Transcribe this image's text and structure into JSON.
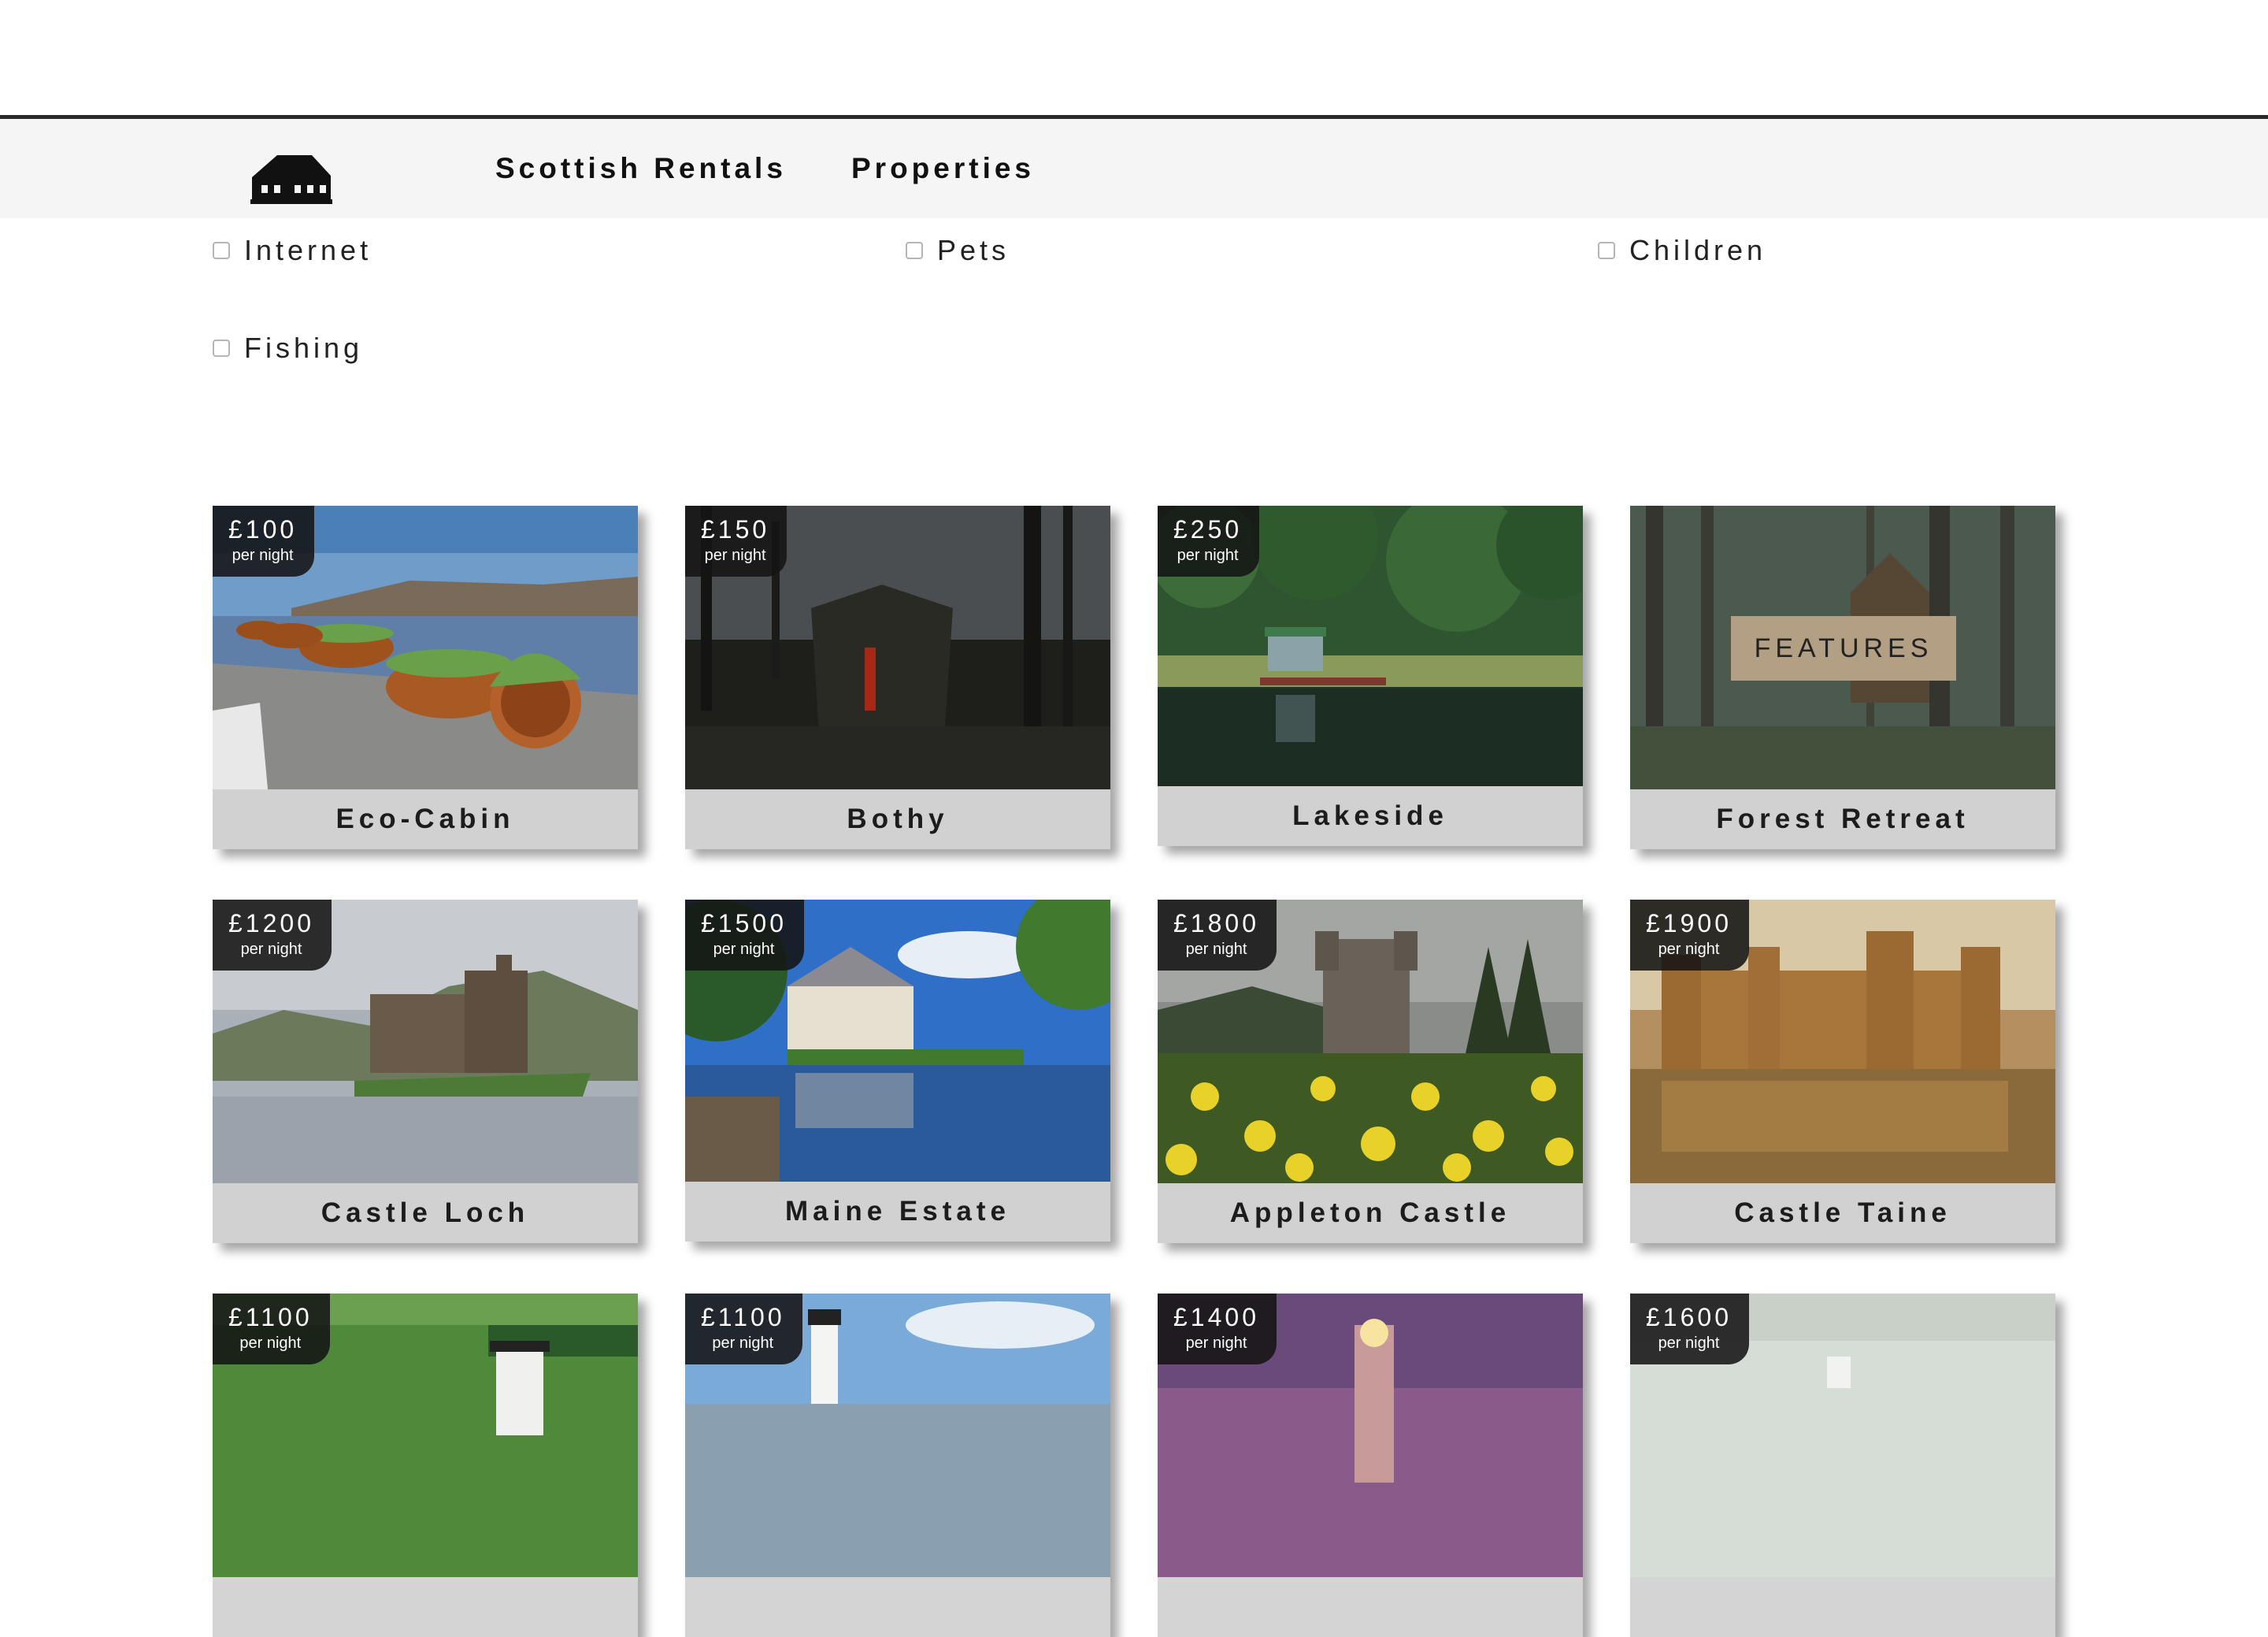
{
  "nav": {
    "logo": "cabin-logo-icon",
    "links": [
      "Scottish Rentals",
      "Properties"
    ]
  },
  "filters": [
    {
      "label": "Internet",
      "checked": false
    },
    {
      "label": "Pets",
      "checked": false
    },
    {
      "label": "Children",
      "checked": false
    },
    {
      "label": "Fishing",
      "checked": false
    }
  ],
  "properties": [
    {
      "name": "Eco-Cabin",
      "price": "£100",
      "unit": "per night"
    },
    {
      "name": "Bothy",
      "price": "£150",
      "unit": "per night"
    },
    {
      "name": "Lakeside",
      "price": "£250",
      "unit": "per night"
    },
    {
      "name": "Forest Retreat",
      "price": "",
      "unit": "",
      "overlay": "FEATURES"
    },
    {
      "name": "Castle Loch",
      "price": "£1200",
      "unit": "per night"
    },
    {
      "name": "Maine Estate",
      "price": "£1500",
      "unit": "per night"
    },
    {
      "name": "Appleton Castle",
      "price": "£1800",
      "unit": "per night"
    },
    {
      "name": "Castle Taine",
      "price": "£1900",
      "unit": "per night"
    },
    {
      "name": "",
      "price": "£1100",
      "unit": "per night"
    },
    {
      "name": "",
      "price": "£1100",
      "unit": "per night"
    },
    {
      "name": "",
      "price": "£1400",
      "unit": "per night"
    },
    {
      "name": "",
      "price": "£1600",
      "unit": "per night"
    }
  ]
}
